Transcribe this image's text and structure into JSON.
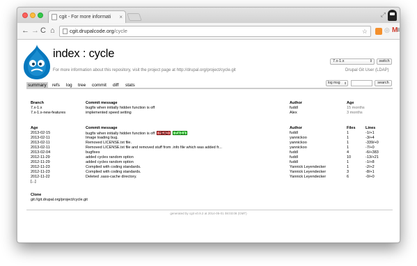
{
  "browser": {
    "tab_title": "cgit - For more informati",
    "url_host": "cgit.drupalcode.org",
    "url_path": "/cycle",
    "colors": {
      "close": "#fc605c",
      "minimize": "#fdbc40",
      "maximize": "#34c84a"
    }
  },
  "header": {
    "title": "index : cycle",
    "description": "For more information about this repository, visit the project page at http://drupal.org/project/cycle.git",
    "branch_selected": "7.x-1.x",
    "switch_label": "switch",
    "owner": "Drupal Git User (LDAP)"
  },
  "nav": {
    "tabs": [
      "summary",
      "refs",
      "log",
      "tree",
      "commit",
      "diff",
      "stats"
    ],
    "active": "summary",
    "search_mode": "log msg",
    "search_label": "search"
  },
  "branches": {
    "headers": [
      "Branch",
      "Commit message",
      "Author",
      "Age"
    ],
    "rows": [
      [
        "7.x-1.x",
        "bugfix when initially hidden function is off",
        "fuddl",
        "15 months"
      ],
      [
        "7.x-1.x-new-features",
        "implemented speed setting",
        "Alex",
        "3 months"
      ]
    ]
  },
  "commits": {
    "headers": [
      "Age",
      "Commit message",
      "Author",
      "Files",
      "Lines"
    ],
    "rows": [
      [
        "2013-02-15",
        "bugfix when initially hidden function is off",
        "fuddl",
        "1",
        "-1/+1"
      ],
      [
        "2013-02-11",
        "Image loading bug.",
        "yannickoo",
        "1",
        "-3/+4"
      ],
      [
        "2013-02-11",
        "Removed LICENSE.txt file.",
        "yannickoo",
        "1",
        "-339/+0"
      ],
      [
        "2013-02-11",
        "Removed LICENSE.txt file and removed stuff from .info file which was added fr...",
        "yannickoo",
        "1",
        "-7/+0"
      ],
      [
        "2013-02-04",
        "bugfixes",
        "fuddl",
        "4",
        "-6/+383"
      ],
      [
        "2012-11-29",
        "added cycles random option",
        "fuddl",
        "10",
        "-13/+21"
      ],
      [
        "2012-11-29",
        "added cycles random option",
        "fuddl",
        "1",
        "-1/+8"
      ],
      [
        "2012-11-23",
        "Complied with coding standards.",
        "Yannick Leyendecker",
        "1",
        "-2/+2"
      ],
      [
        "2012-11-23",
        "Complied with coding standards.",
        "Yannick Leyendecker",
        "3",
        "-8/+1"
      ],
      [
        "2012-11-22",
        "Deleted .sass-cache directory.",
        "Yannick Leyendecker",
        "6",
        "-0/+0"
      ]
    ],
    "head_badge": "HEAD",
    "branch_badge": "7.x-1.x",
    "more": "[...]"
  },
  "clone": {
    "label": "Clone",
    "url": "git://git.drupal.org/project/cycle.git"
  },
  "footer": "generated by cgit v0.9.2 at 2014-05-01 08:03:08 (GMT)"
}
